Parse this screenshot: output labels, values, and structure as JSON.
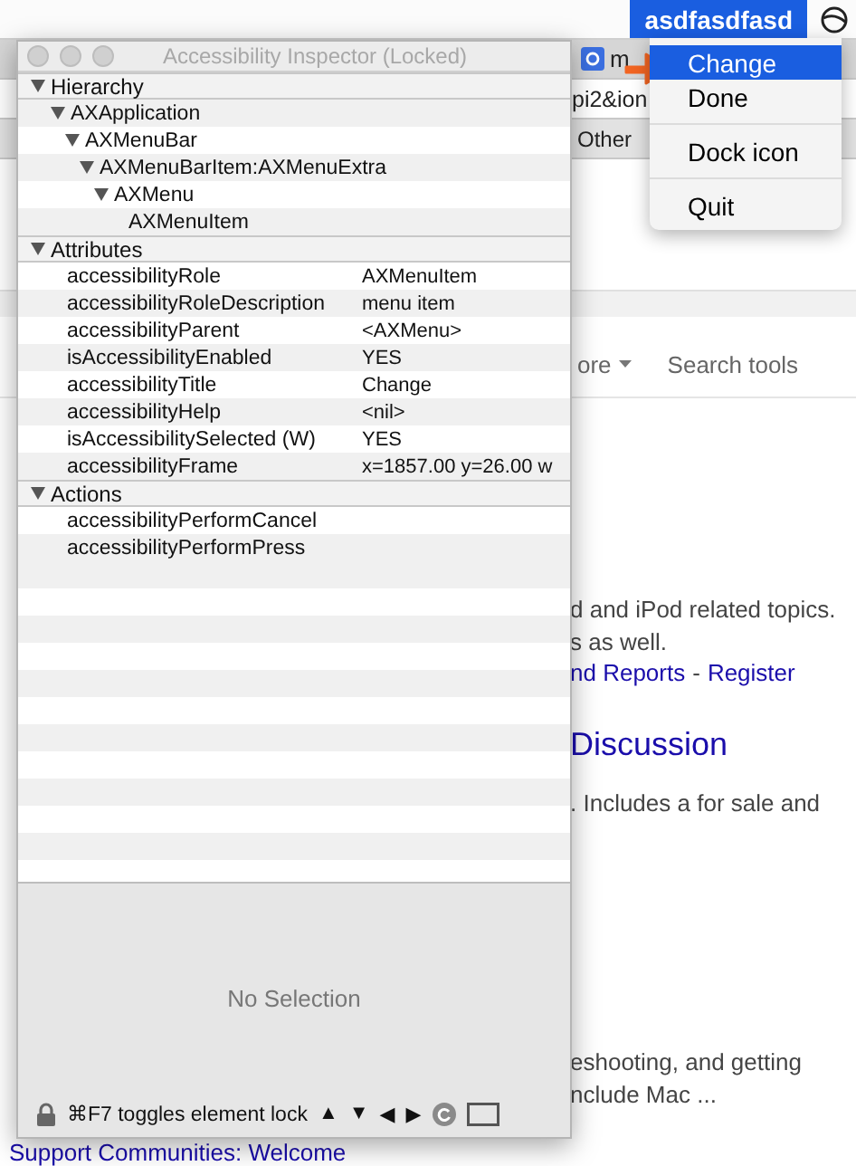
{
  "menu_bar": {
    "status_title": "asdfasdfasd",
    "selected": true
  },
  "status_menu": {
    "items": [
      {
        "kind": "item",
        "label": "Change",
        "selected": true
      },
      {
        "kind": "item",
        "label": "Done",
        "selected": false
      },
      {
        "kind": "separator"
      },
      {
        "kind": "item",
        "label": "Dock icon",
        "selected": false
      },
      {
        "kind": "separator"
      },
      {
        "kind": "item",
        "label": "Quit",
        "selected": false
      }
    ]
  },
  "browser": {
    "tab_label": "m",
    "address_fragment": "pi2&ion",
    "bookmark": "Other",
    "search_options": [
      {
        "kind": "dropdown",
        "label": "ore"
      },
      {
        "kind": "plain",
        "label": "Search tools"
      }
    ],
    "result_blocks": [
      {
        "lines": [
          {
            "kind": "snippet",
            "text": "d and iPod related topics."
          },
          {
            "kind": "snippet",
            "text": "s as well."
          },
          {
            "kind": "links",
            "links": [
              "nd Reports",
              "Register"
            ],
            "separator": "-"
          }
        ]
      },
      {
        "lines": [
          {
            "kind": "heading",
            "text": "Discussion"
          },
          {
            "kind": "snippet",
            "text": ". Includes a for sale and"
          }
        ]
      },
      {
        "lines": [
          {
            "kind": "snippet",
            "text": "eshooting, and getting"
          },
          {
            "kind": "snippet",
            "text": "nclude Mac ..."
          }
        ]
      }
    ],
    "bottom_heading": "Support Communities: Welcome"
  },
  "inspector": {
    "title": "Accessibility Inspector (Locked)",
    "sections": [
      {
        "kind": "tree",
        "title": "Hierarchy",
        "expanded": true,
        "nodes": [
          {
            "label": "AXApplication",
            "expanded": true,
            "children": [
              {
                "label": "AXMenuBar",
                "expanded": true,
                "children": [
                  {
                    "label": "AXMenuBarItem:AXMenuExtra",
                    "expanded": true,
                    "children": [
                      {
                        "label": "AXMenu",
                        "expanded": true,
                        "children": [
                          {
                            "label": "AXMenuItem"
                          }
                        ]
                      }
                    ]
                  }
                ]
              }
            ]
          }
        ]
      },
      {
        "kind": "attributes",
        "title": "Attributes",
        "expanded": true,
        "rows": [
          {
            "name": "accessibilityRole",
            "value": "AXMenuItem"
          },
          {
            "name": "accessibilityRoleDescription",
            "value": "menu item"
          },
          {
            "name": "accessibilityParent",
            "value": "<AXMenu>"
          },
          {
            "name": "isAccessibilityEnabled",
            "value": "YES"
          },
          {
            "name": "accessibilityTitle",
            "value": "Change"
          },
          {
            "name": "accessibilityHelp",
            "value": "<nil>"
          },
          {
            "name": "isAccessibilitySelected (W)",
            "value": "YES"
          },
          {
            "name": "accessibilityFrame",
            "value": "x=1857.00 y=26.00 w"
          }
        ]
      },
      {
        "kind": "actions",
        "title": "Actions",
        "expanded": true,
        "items": [
          "accessibilityPerformCancel",
          "accessibilityPerformPress"
        ]
      }
    ],
    "detail_placeholder": "No Selection",
    "lock_hint": "⌘F7 toggles element lock",
    "nav_buttons": [
      "▲",
      "▼",
      "◀",
      "▶"
    ]
  }
}
